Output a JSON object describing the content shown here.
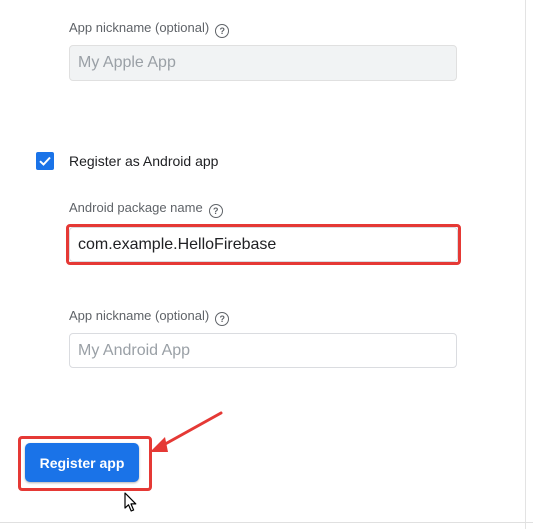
{
  "ios_app": {
    "nickname_label": "App nickname (optional)",
    "nickname_placeholder": "My Apple App"
  },
  "android": {
    "checkbox_label": "Register as Android app",
    "checked": true,
    "package_label": "Android package name",
    "package_value": "com.example.HelloFirebase",
    "nickname_label": "App nickname (optional)",
    "nickname_placeholder": "My Android App"
  },
  "actions": {
    "register_label": "Register app"
  },
  "icons": {
    "help": "help-circle-icon",
    "check": "check-icon",
    "cursor": "mouse-pointer-icon"
  },
  "colors": {
    "accent": "#1a73e8",
    "annotation": "#e53935",
    "label": "#5f6368"
  }
}
